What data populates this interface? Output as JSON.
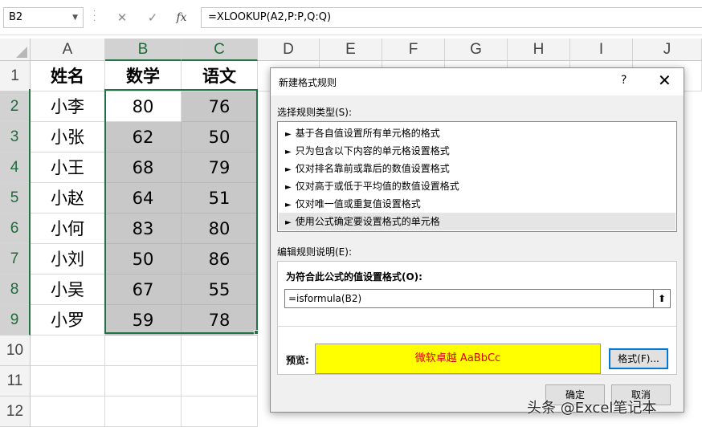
{
  "formula_bar": {
    "name_box": "B2",
    "cancel_icon": "✕",
    "enter_icon": "✓",
    "fx_label": "fx",
    "formula": "=XLOOKUP(A2,P:P,Q:Q)"
  },
  "columns": [
    "A",
    "B",
    "C",
    "D",
    "E",
    "F",
    "G",
    "H",
    "I",
    "J"
  ],
  "rows": [
    "1",
    "2",
    "3",
    "4",
    "5",
    "6",
    "7",
    "8",
    "9",
    "10",
    "11",
    "12"
  ],
  "table": {
    "headers": [
      "姓名",
      "数学",
      "语文"
    ],
    "names": [
      "小李",
      "小张",
      "小王",
      "小赵",
      "小何",
      "小刘",
      "小吴",
      "小罗"
    ],
    "math": [
      "80",
      "62",
      "68",
      "64",
      "83",
      "50",
      "67",
      "59"
    ],
    "chinese": [
      "76",
      "50",
      "79",
      "51",
      "80",
      "86",
      "55",
      "78"
    ]
  },
  "dialog": {
    "title": "新建格式规则",
    "help": "?",
    "close": "✕",
    "select_type_label": "选择规则类型(S):",
    "rule_types": [
      "基于各自值设置所有单元格的格式",
      "只为包含以下内容的单元格设置格式",
      "仅对排名靠前或靠后的数值设置格式",
      "仅对高于或低于平均值的数值设置格式",
      "仅对唯一值或重复值设置格式",
      "使用公式确定要设置格式的单元格"
    ],
    "rule_arrow": "►",
    "edit_desc_label": "编辑规则说明(E):",
    "formula_label": "为符合此公式的值设置格式(O):",
    "formula_value": "=isformula(B2)",
    "collapse_icon": "⬆",
    "preview_label": "预览:",
    "preview_text": "微软卓越  AaBbCc",
    "format_button": "格式(F)...",
    "ok_button": "确定",
    "cancel_button": "取消"
  },
  "watermark": "头条 @Excel笔记本",
  "colors": {
    "selection_green": "#217346",
    "preview_bg": "#ffff00",
    "preview_text": "#e00000"
  }
}
